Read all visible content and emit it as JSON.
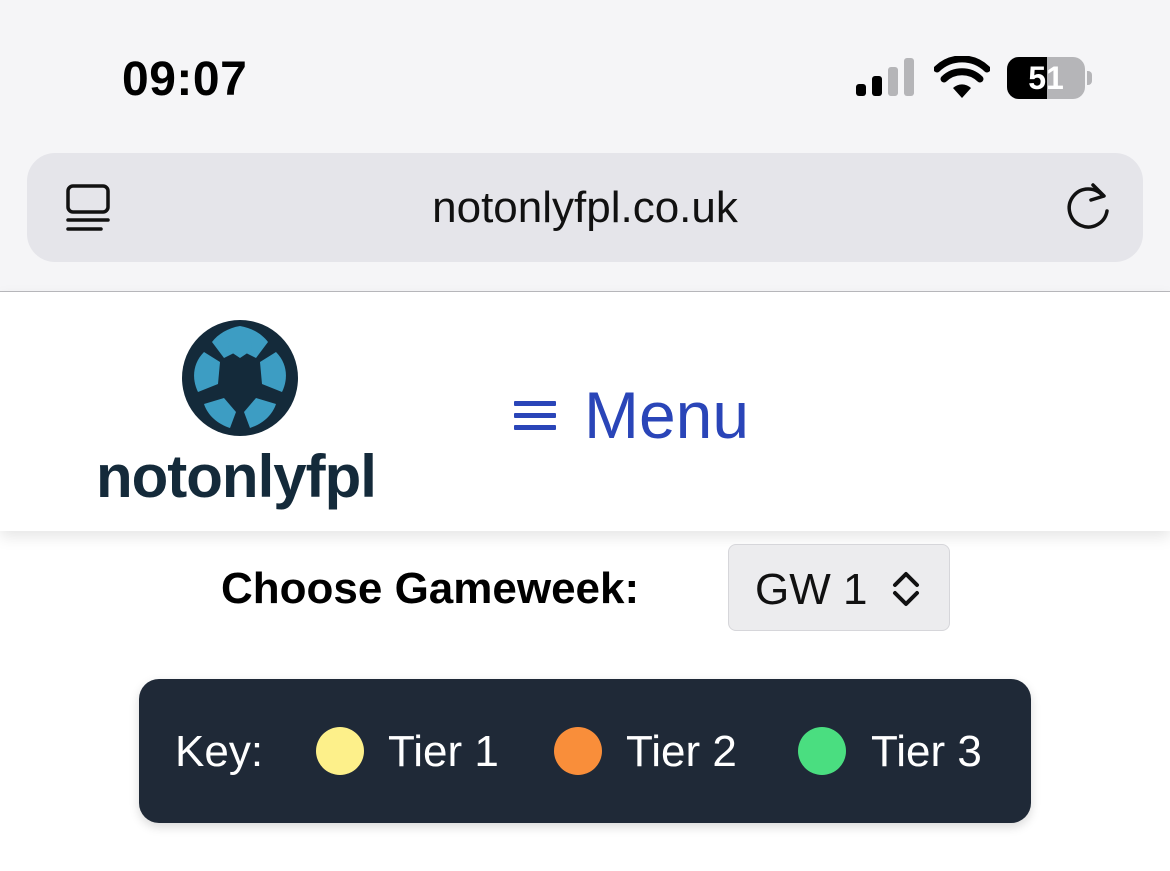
{
  "status_bar": {
    "time": "09:07",
    "battery": "51",
    "battery_level": 0.51
  },
  "browser": {
    "url": "notonlyfpl.co.uk"
  },
  "header": {
    "logo_text": "notonlyfpl",
    "menu_label": "Menu"
  },
  "gameweek": {
    "label": "Choose Gameweek:",
    "selected": "GW 1"
  },
  "key": {
    "label": "Key:",
    "tiers": [
      {
        "label": "Tier 1",
        "color": "#fdf08a"
      },
      {
        "label": "Tier 2",
        "color": "#f98e3a"
      },
      {
        "label": "Tier 3",
        "color": "#4ade80"
      }
    ]
  },
  "colors": {
    "menu_accent": "#2a45b8",
    "logo_dark": "#142a3a",
    "ball_blue": "#3d9dc3",
    "key_bg": "#1f2937"
  }
}
